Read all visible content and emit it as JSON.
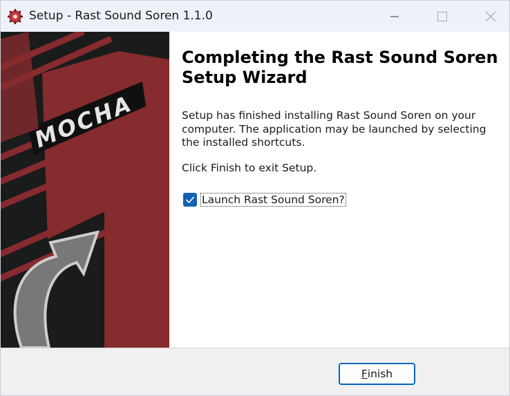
{
  "window": {
    "title": "Setup - Rast Sound Soren 1.1.0"
  },
  "banner": {
    "logo_text": "MOCHA"
  },
  "content": {
    "heading": "Completing the Rast Sound Soren Setup Wizard",
    "body": "Setup has finished installing Rast Sound Soren on your computer. The application may be launched by selecting the installed shortcuts.",
    "exit_instruction": "Click Finish to exit Setup.",
    "launch_checkbox": {
      "label": "Launch Rast Sound Soren?",
      "checked": true
    }
  },
  "footer": {
    "finish_accel": "F",
    "finish_rest": "inish"
  },
  "colors": {
    "accent": "#1262b5",
    "banner_red": "#8e2e31",
    "banner_dark": "#1c1d1d"
  }
}
